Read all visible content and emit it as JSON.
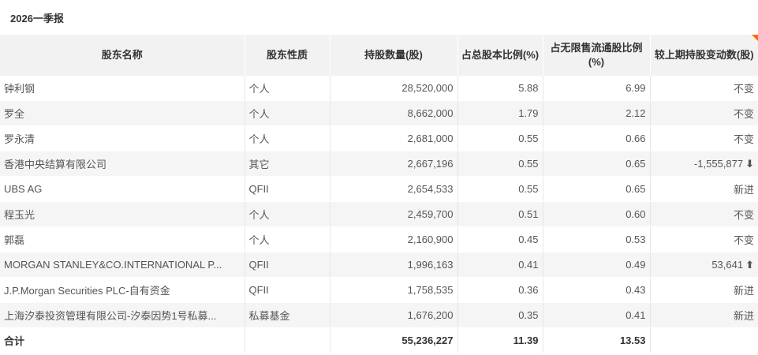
{
  "page": {
    "period_title": "2026一季报"
  },
  "table": {
    "headers": [
      "股东名称",
      "股东性质",
      "持股数量(股)",
      "占总股本比例(%)",
      "占无限售流通股比例(%)",
      "较上期持股变动数(股)"
    ],
    "rows": [
      {
        "name": "钟利钢",
        "nature": "个人",
        "shares": "28,520,000",
        "total_pct": "5.88",
        "float_pct": "6.99",
        "change": "不变",
        "change_dir": "none"
      },
      {
        "name": "罗全",
        "nature": "个人",
        "shares": "8,662,000",
        "total_pct": "1.79",
        "float_pct": "2.12",
        "change": "不变",
        "change_dir": "none"
      },
      {
        "name": "罗永清",
        "nature": "个人",
        "shares": "2,681,000",
        "total_pct": "0.55",
        "float_pct": "0.66",
        "change": "不变",
        "change_dir": "none"
      },
      {
        "name": "香港中央结算有限公司",
        "nature": "其它",
        "shares": "2,667,196",
        "total_pct": "0.55",
        "float_pct": "0.65",
        "change": "-1,555,877",
        "change_dir": "down"
      },
      {
        "name": "UBS AG",
        "nature": "QFII",
        "shares": "2,654,533",
        "total_pct": "0.55",
        "float_pct": "0.65",
        "change": "新进",
        "change_dir": "none"
      },
      {
        "name": "程玉光",
        "nature": "个人",
        "shares": "2,459,700",
        "total_pct": "0.51",
        "float_pct": "0.60",
        "change": "不变",
        "change_dir": "none"
      },
      {
        "name": "郭磊",
        "nature": "个人",
        "shares": "2,160,900",
        "total_pct": "0.45",
        "float_pct": "0.53",
        "change": "不变",
        "change_dir": "none"
      },
      {
        "name": "MORGAN STANLEY&CO.INTERNATIONAL P...",
        "nature": "QFII",
        "shares": "1,996,163",
        "total_pct": "0.41",
        "float_pct": "0.49",
        "change": "53,641",
        "change_dir": "up"
      },
      {
        "name": "J.P.Morgan Securities PLC-自有资金",
        "nature": "QFII",
        "shares": "1,758,535",
        "total_pct": "0.36",
        "float_pct": "0.43",
        "change": "新进",
        "change_dir": "none"
      },
      {
        "name": "上海汐泰投资管理有限公司-汐泰因势1号私募...",
        "nature": "私募基金",
        "shares": "1,676,200",
        "total_pct": "0.35",
        "float_pct": "0.41",
        "change": "新进",
        "change_dir": "none"
      }
    ],
    "total": {
      "label": "合计",
      "shares": "55,236,227",
      "total_pct": "11.39",
      "float_pct": "13.53"
    }
  },
  "colors": {
    "decrease": "#2e9a2e",
    "increase": "#e00000",
    "corner_accent": "#ff6a00",
    "header_bg": "#f2f2f2"
  },
  "icons": {
    "decrease": "arrow-down-icon",
    "increase": "arrow-up-icon"
  }
}
